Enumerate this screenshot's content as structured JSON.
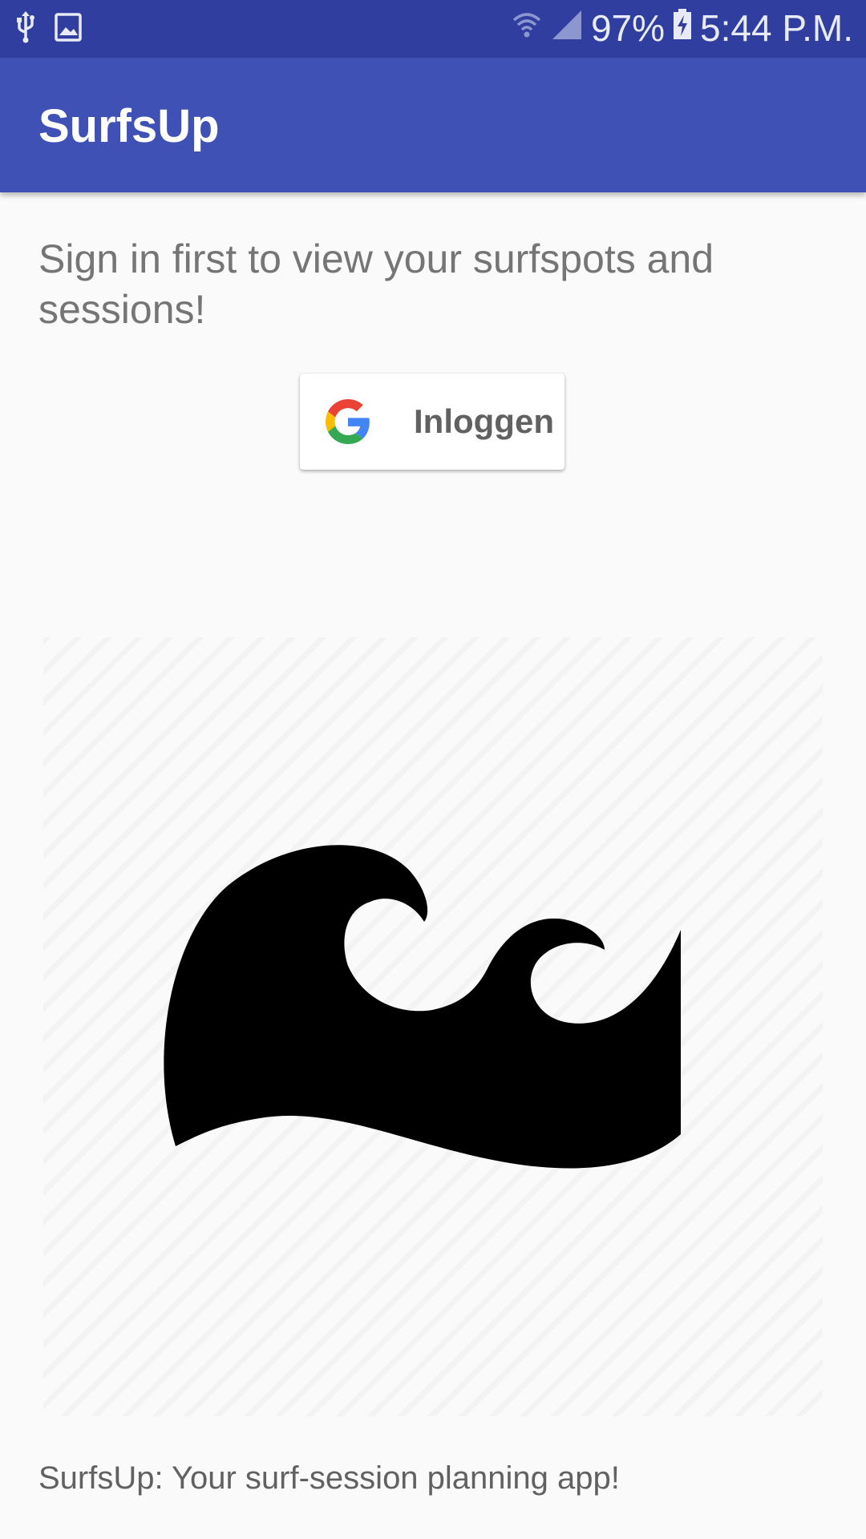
{
  "status_bar": {
    "battery": "97%",
    "time": "5:44 P.M.",
    "icons": [
      "usb-icon",
      "image-icon",
      "wifi-icon",
      "signal-icon",
      "battery-charging-icon"
    ]
  },
  "app_bar": {
    "title": "SurfsUp",
    "color": "#3f51b5"
  },
  "content": {
    "intro_text": "Sign in first to view your surfspots and sessions!",
    "signin_button_label": "Inloggen",
    "hero_icon": "wave-icon",
    "tagline": "SurfsUp: Your surf-session planning app!"
  },
  "colors": {
    "status_bar": "#303f9f",
    "app_bar": "#3f51b5",
    "background": "#fafafa"
  }
}
